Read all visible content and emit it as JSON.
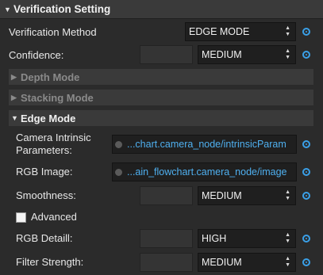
{
  "header": {
    "title": "Verification Setting"
  },
  "verification_method": {
    "label": "Verification Method",
    "value": "EDGE MODE"
  },
  "confidence": {
    "label": "Confidence:",
    "value": "MEDIUM"
  },
  "groups": {
    "depth_mode": "Depth Mode",
    "stacking_mode": "Stacking Mode",
    "edge_mode": "Edge Mode"
  },
  "edge": {
    "camera_intrinsic": {
      "label_line1": "Camera Intrinsic",
      "label_line2": "Parameters:",
      "value": "...chart.camera_node/intrinsicParam"
    },
    "rgb_image": {
      "label": "RGB Image:",
      "value": "...ain_flowchart.camera_node/image"
    },
    "smoothness": {
      "label": "Smoothness:",
      "value": "MEDIUM"
    },
    "advanced": {
      "label": "Advanced",
      "checked": false
    },
    "rgb_detail": {
      "label": "RGB Detaill:",
      "value": "HIGH"
    },
    "filter_strength": {
      "label": "Filter Strength:",
      "value": "MEDIUM"
    }
  },
  "colors": {
    "accent": "#3aa0e8",
    "link": "#4fb0f0",
    "background": "#2b2b2b",
    "panel": "#3a3a3a"
  }
}
